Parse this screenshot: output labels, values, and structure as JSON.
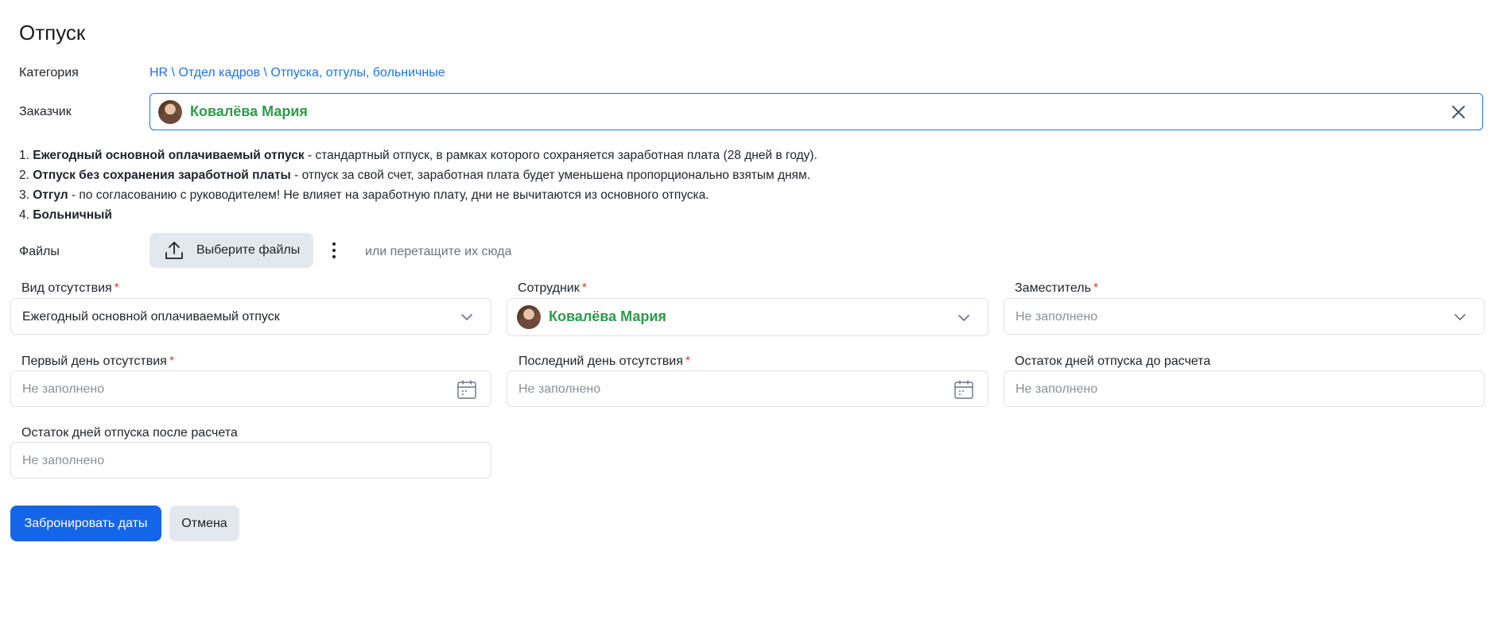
{
  "page": {
    "title": "Отпуск"
  },
  "category": {
    "label": "Категория",
    "path": [
      "HR",
      "Отдел кадров",
      "Отпуска, отгулы, больничные"
    ],
    "separator": " \\ "
  },
  "customer": {
    "label": "Заказчик",
    "name": "Ковалёва Мария"
  },
  "description": [
    {
      "num": "1.",
      "bold": "Ежегодный основной оплачиваемый отпуск",
      "rest": " - стандартный отпуск, в рамках которого сохраняется заработная плата (28 дней в году)."
    },
    {
      "num": "2.",
      "bold": "Отпуск без сохранения заработной платы",
      "rest": " - отпуск за свой счет, заработная плата будет уменьшена пропорционально взятым дням."
    },
    {
      "num": "3.",
      "bold": "Отгул",
      "rest": " - по согласованию с руководителем! Не влияет на заработную плату, дни не вычитаются из основного отпуска."
    },
    {
      "num": "4.",
      "bold": "Больничный",
      "rest": ""
    }
  ],
  "files": {
    "label": "Файлы",
    "button": "Выберите файлы",
    "hint": "или перетащите их сюда"
  },
  "fields": {
    "absence_type": {
      "label": "Вид отсутствия",
      "value": "Ежегодный основной оплачиваемый отпуск",
      "required": true
    },
    "employee": {
      "label": "Сотрудник",
      "value": "Ковалёва Мария",
      "required": true
    },
    "deputy": {
      "label": "Заместитель",
      "placeholder": "Не заполнено",
      "required": true
    },
    "first_day": {
      "label": "Первый день отсутствия",
      "placeholder": "Не заполнено",
      "required": true
    },
    "last_day": {
      "label": "Последний день отсутствия",
      "placeholder": "Не заполнено",
      "required": true
    },
    "balance_before": {
      "label": "Остаток дней отпуска до расчета",
      "placeholder": "Не заполнено",
      "required": false
    },
    "balance_after": {
      "label": "Остаток дней отпуска после расчета",
      "placeholder": "Не заполнено",
      "required": false
    }
  },
  "required_mark": "*",
  "actions": {
    "submit": "Забронировать даты",
    "cancel": "Отмена"
  },
  "colors": {
    "accent": "#1565e8",
    "link": "#1a73e8",
    "person_name": "#2e9b4a",
    "required": "#e53935",
    "secondary_button": "#e3e8ef"
  },
  "icons": {
    "clear": "close-icon",
    "upload": "upload-icon",
    "more": "more-vertical-icon",
    "dropdown": "chevron-down-icon",
    "calendar": "calendar-icon"
  }
}
